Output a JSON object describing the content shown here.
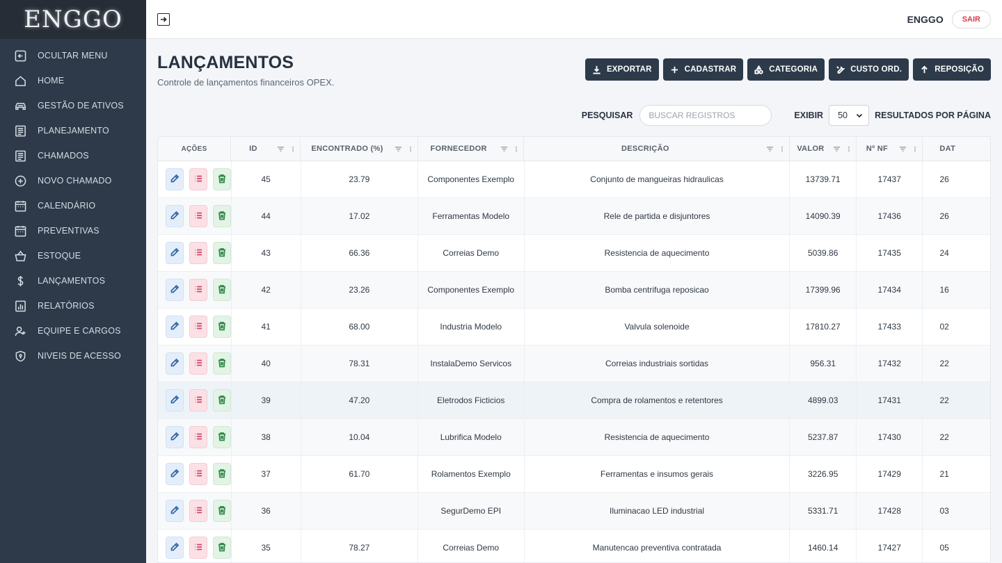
{
  "app": {
    "logo": "ENGGO"
  },
  "sidebar": {
    "items": [
      {
        "label": "OCULTAR MENU",
        "icon": "collapse-icon"
      },
      {
        "label": "HOME",
        "icon": "home-icon"
      },
      {
        "label": "GESTÃO DE ATIVOS",
        "icon": "car-icon"
      },
      {
        "label": "PLANEJAMENTO",
        "icon": "document-icon"
      },
      {
        "label": "CHAMADOS",
        "icon": "document-icon"
      },
      {
        "label": "NOVO CHAMADO",
        "icon": "plus-circle-icon"
      },
      {
        "label": "CALENDÁRIO",
        "icon": "calendar-icon"
      },
      {
        "label": "PREVENTIVAS",
        "icon": "calendar-icon"
      },
      {
        "label": "ESTOQUE",
        "icon": "basket-icon"
      },
      {
        "label": "LANÇAMENTOS",
        "icon": "dollar-icon"
      },
      {
        "label": "RELATÓRIOS",
        "icon": "report-icon"
      },
      {
        "label": "EQUIPE E CARGOS",
        "icon": "user-plus-icon"
      },
      {
        "label": "NIVEIS DE ACESSO",
        "icon": "shield-icon"
      }
    ]
  },
  "topbar": {
    "username": "ENGGO",
    "logout": "SAIR"
  },
  "page": {
    "title": "LANÇAMENTOS",
    "subtitle": "Controle de lançamentos financeiros OPEX."
  },
  "toolbar": {
    "buttons": [
      {
        "label": "EXPORTAR",
        "icon": "download-icon"
      },
      {
        "label": "CADASTRAR",
        "icon": "plus-icon"
      },
      {
        "label": "CATEGORIA",
        "icon": "shapes-icon"
      },
      {
        "label": "CUSTO ORD.",
        "icon": "wrench-icon"
      },
      {
        "label": "REPOSIÇÃO",
        "icon": "arrow-up-icon"
      }
    ]
  },
  "filters": {
    "search_label": "PESQUISAR",
    "search_placeholder": "BUSCAR REGISTROS",
    "show_label": "EXIBIR",
    "page_size": "50",
    "per_page_label": "RESULTADOS POR PÁGINA"
  },
  "table": {
    "columns": [
      "AÇÕES",
      "ID",
      "ENCONTRADO (%)",
      "FORNECEDOR",
      "DESCRIÇÃO",
      "VALOR",
      "Nº NF",
      "DAT"
    ],
    "rows": [
      {
        "id": "45",
        "enc": "23.79",
        "forn": "Componentes Exemplo",
        "desc": "Conjunto de mangueiras hidraulicas",
        "valor": "13739.71",
        "nf": "17437",
        "data": "26"
      },
      {
        "id": "44",
        "enc": "17.02",
        "forn": "Ferramentas Modelo",
        "desc": "Rele de partida e disjuntores",
        "valor": "14090.39",
        "nf": "17436",
        "data": "26"
      },
      {
        "id": "43",
        "enc": "66.36",
        "forn": "Correias Demo",
        "desc": "Resistencia de aquecimento",
        "valor": "5039.86",
        "nf": "17435",
        "data": "24"
      },
      {
        "id": "42",
        "enc": "23.26",
        "forn": "Componentes Exemplo",
        "desc": "Bomba centrifuga reposicao",
        "valor": "17399.96",
        "nf": "17434",
        "data": "16"
      },
      {
        "id": "41",
        "enc": "68.00",
        "forn": "Industria Modelo",
        "desc": "Valvula solenoide",
        "valor": "17810.27",
        "nf": "17433",
        "data": "02"
      },
      {
        "id": "40",
        "enc": "78.31",
        "forn": "InstalaDemo Servicos",
        "desc": "Correias industriais sortidas",
        "valor": "956.31",
        "nf": "17432",
        "data": "22"
      },
      {
        "id": "39",
        "enc": "47.20",
        "forn": "Eletrodos Ficticios",
        "desc": "Compra de rolamentos e retentores",
        "valor": "4899.03",
        "nf": "17431",
        "data": "22"
      },
      {
        "id": "38",
        "enc": "10.04",
        "forn": "Lubrifica Modelo",
        "desc": "Resistencia de aquecimento",
        "valor": "5237.87",
        "nf": "17430",
        "data": "22"
      },
      {
        "id": "37",
        "enc": "61.70",
        "forn": "Rolamentos Exemplo",
        "desc": "Ferramentas e insumos gerais",
        "valor": "3226.95",
        "nf": "17429",
        "data": "21"
      },
      {
        "id": "36",
        "enc": "",
        "forn": "SegurDemo EPI",
        "desc": "Iluminacao LED industrial",
        "valor": "5331.71",
        "nf": "17428",
        "data": "03"
      },
      {
        "id": "35",
        "enc": "78.27",
        "forn": "Correias Demo",
        "desc": "Manutencao preventiva contratada",
        "valor": "1460.14",
        "nf": "17427",
        "data": "05"
      }
    ]
  }
}
